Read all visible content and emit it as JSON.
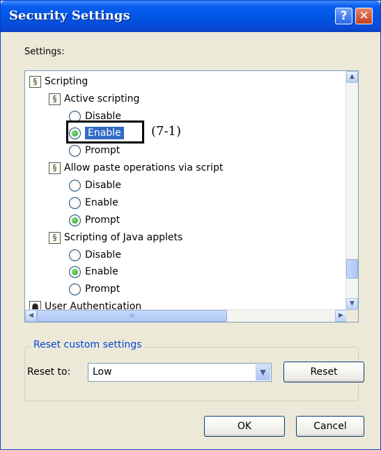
{
  "window": {
    "title": "Security Settings",
    "help_glyph": "?",
    "close_glyph": "✕"
  },
  "settings_label": "Settings:",
  "tree": {
    "items": [
      {
        "label": "Scripting",
        "kind": "category"
      },
      {
        "label": "Active scripting",
        "kind": "setting"
      },
      {
        "label": "Disable",
        "kind": "option",
        "checked": false
      },
      {
        "label": "Enable",
        "kind": "option",
        "checked": true,
        "selected": true
      },
      {
        "label": "Prompt",
        "kind": "option",
        "checked": false
      },
      {
        "label": "Allow paste operations via script",
        "kind": "setting"
      },
      {
        "label": "Disable",
        "kind": "option",
        "checked": false
      },
      {
        "label": "Enable",
        "kind": "option",
        "checked": false
      },
      {
        "label": "Prompt",
        "kind": "option",
        "checked": true
      },
      {
        "label": "Scripting of Java applets",
        "kind": "setting"
      },
      {
        "label": "Disable",
        "kind": "option",
        "checked": false
      },
      {
        "label": "Enable",
        "kind": "option",
        "checked": true
      },
      {
        "label": "Prompt",
        "kind": "option",
        "checked": false
      },
      {
        "label": "User Authentication",
        "kind": "category"
      }
    ],
    "annotation": "(7-1)",
    "hscroll_grip": "III"
  },
  "reset_group": {
    "title": "Reset custom settings",
    "reset_to_label": "Reset to:",
    "reset_to_value": "Low",
    "reset_button": "Reset"
  },
  "buttons": {
    "ok": "OK",
    "cancel": "Cancel"
  },
  "colors": {
    "titlebar": "#0054e3",
    "selection": "#316ac5",
    "radio_checked": "#21a121",
    "group_title": "#0046d5"
  }
}
